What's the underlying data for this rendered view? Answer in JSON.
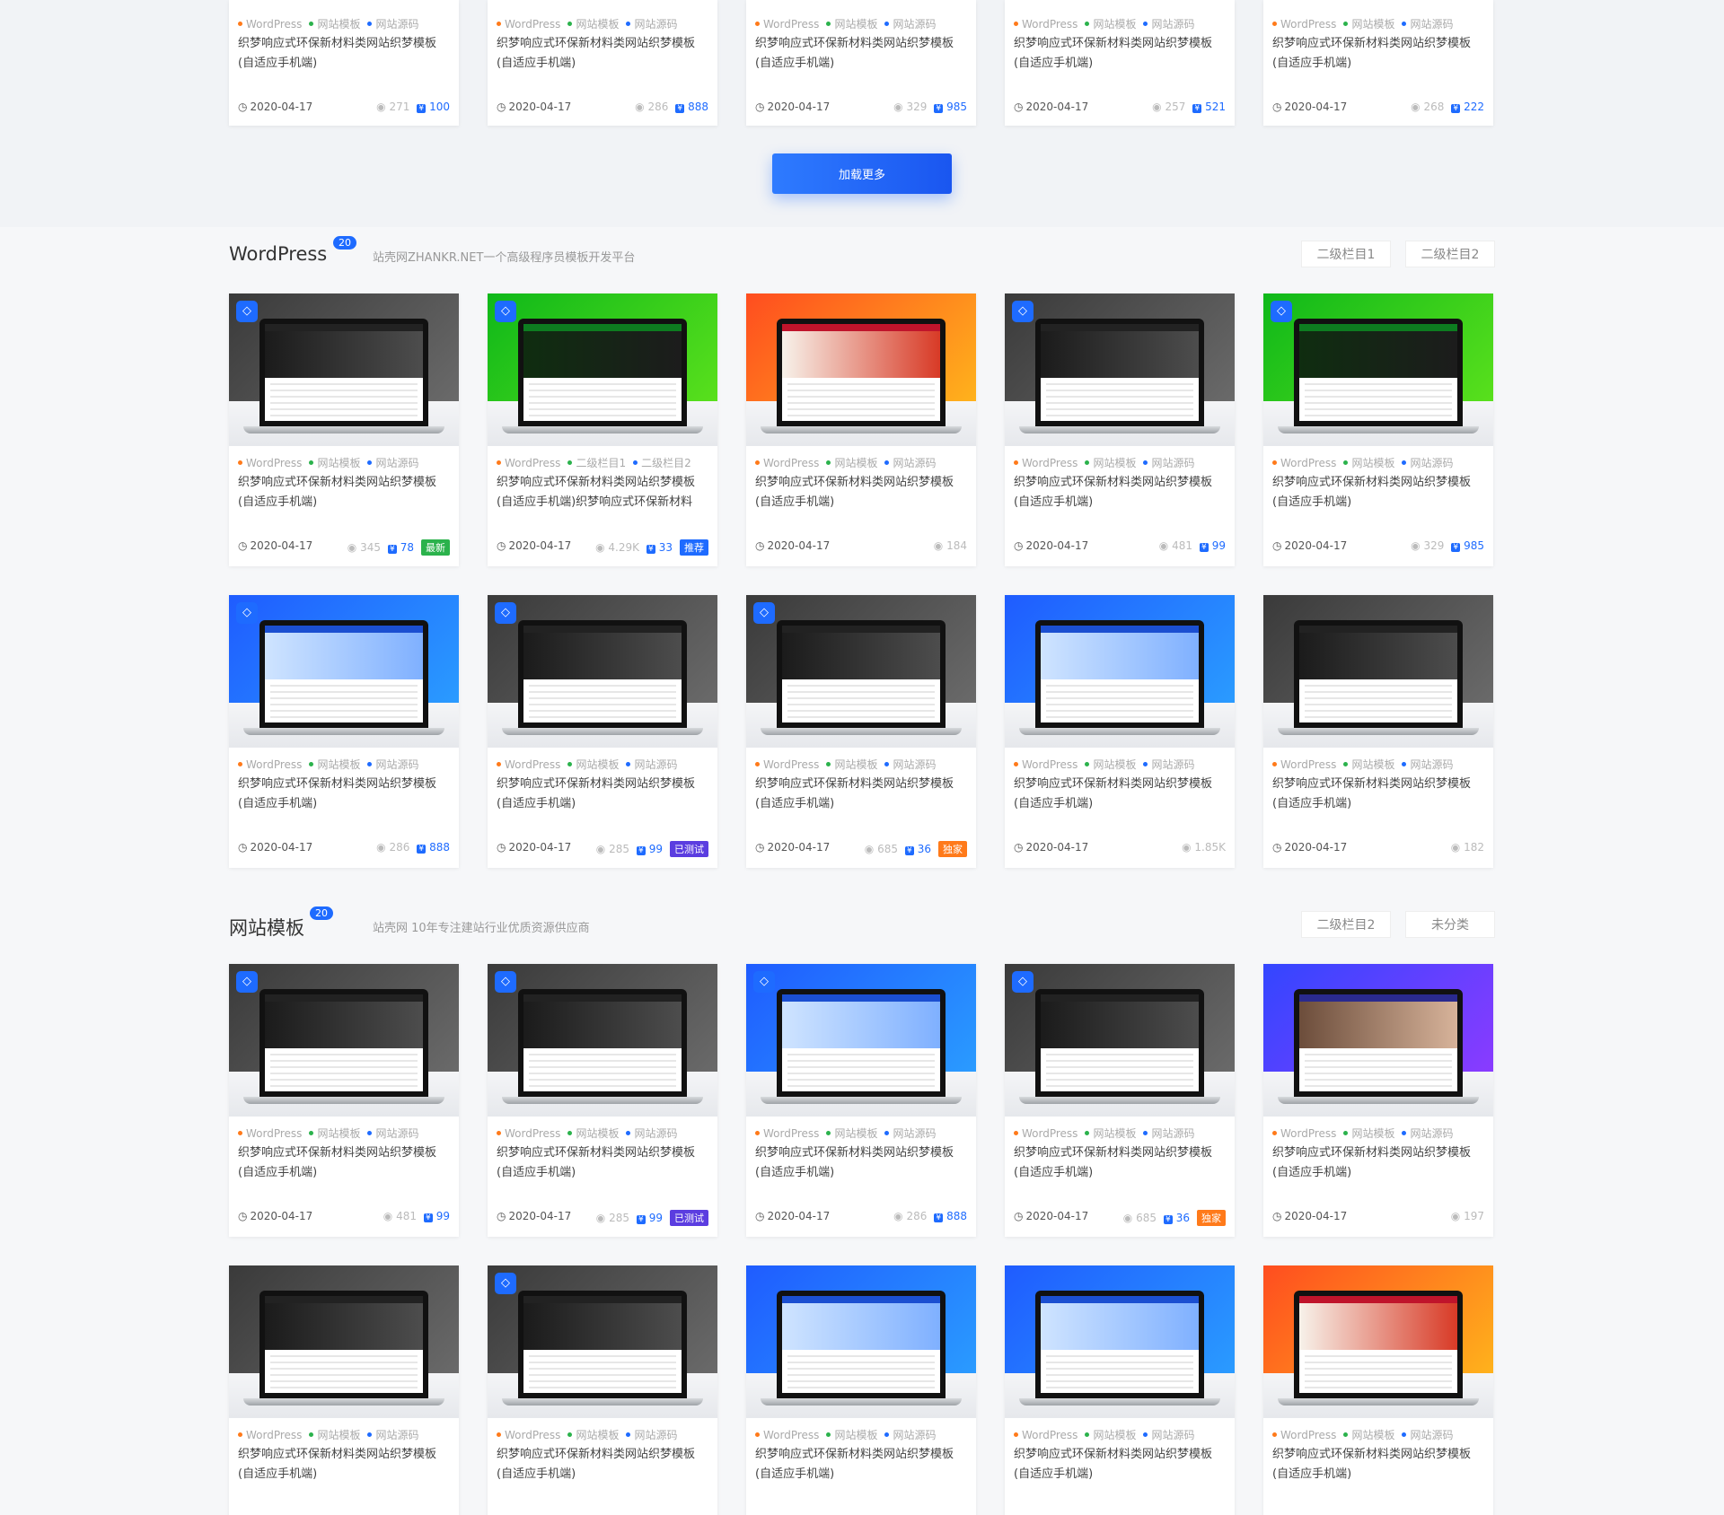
{
  "tag_labels": {
    "wp": "WordPress",
    "tpl": "网站模板",
    "src": "网站源码",
    "c1": "二级栏目1",
    "c2": "二级栏目2"
  },
  "colors": {
    "accent": "#1e6bff",
    "tag_orange": "#ff7a1a",
    "tag_green": "#2bb24c",
    "tag_blue": "#1e6bff"
  },
  "icons": {
    "vip": "diamond-icon",
    "date": "clock-icon",
    "views": "eye-icon",
    "price": "coin-icon"
  },
  "load_more": "加载更多",
  "top_cards": [
    {
      "title": "织梦响应式环保新材料类网站织梦模板(自适应手机端)",
      "date": "2020-04-17",
      "views": "271",
      "price": "100"
    },
    {
      "title": "织梦响应式环保新材料类网站织梦模板(自适应手机端)",
      "date": "2020-04-17",
      "views": "286",
      "price": "888"
    },
    {
      "title": "织梦响应式环保新材料类网站织梦模板(自适应手机端)",
      "date": "2020-04-17",
      "views": "329",
      "price": "985"
    },
    {
      "title": "织梦响应式环保新材料类网站织梦模板(自适应手机端)",
      "date": "2020-04-17",
      "views": "257",
      "price": "521"
    },
    {
      "title": "织梦响应式环保新材料类网站织梦模板(自适应手机端)",
      "date": "2020-04-17",
      "views": "268",
      "price": "222"
    }
  ],
  "sections": [
    {
      "title": "WordPress",
      "count": "20",
      "desc": "站壳网ZHANKR.NET一个高级程序员模板开发平台",
      "tabs": [
        "二级栏目1",
        "二级栏目2"
      ],
      "cards": [
        {
          "title": "织梦响应式环保新材料类网站织梦模板(自适应手机端)",
          "date": "2020-04-17",
          "views": "345",
          "price": "78",
          "badge": "最新",
          "badge_color": "#2bb24c",
          "vip": true,
          "theme": "gray",
          "tags": [
            "wp",
            "tpl",
            "src"
          ]
        },
        {
          "title": "织梦响应式环保新材料类网站织梦模板(自适应手机端)织梦响应式环保新材料",
          "date": "2020-04-17",
          "views": "4.29K",
          "price": "33",
          "badge": "推荐",
          "badge_color": "#1e6bff",
          "vip": true,
          "theme": "green",
          "tags": [
            "wp",
            "c1",
            "c2"
          ]
        },
        {
          "title": "织梦响应式环保新材料类网站织梦模板(自适应手机端)",
          "date": "2020-04-17",
          "views": "184",
          "price": "",
          "badge": "",
          "vip": false,
          "theme": "orange",
          "tags": [
            "wp",
            "tpl",
            "src"
          ]
        },
        {
          "title": "织梦响应式环保新材料类网站织梦模板(自适应手机端)",
          "date": "2020-04-17",
          "views": "481",
          "price": "99",
          "badge": "",
          "vip": true,
          "theme": "gray",
          "tags": [
            "wp",
            "tpl",
            "src"
          ]
        },
        {
          "title": "织梦响应式环保新材料类网站织梦模板(自适应手机端)",
          "date": "2020-04-17",
          "views": "329",
          "price": "985",
          "badge": "",
          "vip": true,
          "theme": "green",
          "tags": [
            "wp",
            "tpl",
            "src"
          ]
        },
        {
          "title": "织梦响应式环保新材料类网站织梦模板(自适应手机端)",
          "date": "2020-04-17",
          "views": "286",
          "price": "888",
          "badge": "",
          "vip": true,
          "theme": "blue",
          "tags": [
            "wp",
            "tpl",
            "src"
          ]
        },
        {
          "title": "织梦响应式环保新材料类网站织梦模板(自适应手机端)",
          "date": "2020-04-17",
          "views": "285",
          "price": "99",
          "badge": "已测试",
          "badge_color": "#5b3de0",
          "vip": true,
          "theme": "gray",
          "tags": [
            "wp",
            "tpl",
            "src"
          ]
        },
        {
          "title": "织梦响应式环保新材料类网站织梦模板(自适应手机端)",
          "date": "2020-04-17",
          "views": "685",
          "price": "36",
          "badge": "独家",
          "badge_color": "#ff7a1a",
          "vip": true,
          "theme": "gray",
          "tags": [
            "wp",
            "tpl",
            "src"
          ]
        },
        {
          "title": "织梦响应式环保新材料类网站织梦模板(自适应手机端)",
          "date": "2020-04-17",
          "views": "1.85K",
          "price": "",
          "badge": "",
          "vip": false,
          "theme": "blue",
          "tags": [
            "wp",
            "tpl",
            "src"
          ]
        },
        {
          "title": "织梦响应式环保新材料类网站织梦模板(自适应手机端)",
          "date": "2020-04-17",
          "views": "182",
          "price": "",
          "badge": "",
          "vip": false,
          "theme": "gray",
          "tags": [
            "wp",
            "tpl",
            "src"
          ]
        }
      ]
    },
    {
      "title": "网站模板",
      "count": "20",
      "desc": "站壳网 10年专注建站行业优质资源供应商",
      "tabs": [
        "二级栏目2",
        "未分类"
      ],
      "cards": [
        {
          "title": "织梦响应式环保新材料类网站织梦模板(自适应手机端)",
          "date": "2020-04-17",
          "views": "481",
          "price": "99",
          "badge": "",
          "vip": true,
          "theme": "gray",
          "tags": [
            "wp",
            "tpl",
            "src"
          ]
        },
        {
          "title": "织梦响应式环保新材料类网站织梦模板(自适应手机端)",
          "date": "2020-04-17",
          "views": "285",
          "price": "99",
          "badge": "已测试",
          "badge_color": "#5b3de0",
          "vip": true,
          "theme": "gray",
          "tags": [
            "wp",
            "tpl",
            "src"
          ]
        },
        {
          "title": "织梦响应式环保新材料类网站织梦模板(自适应手机端)",
          "date": "2020-04-17",
          "views": "286",
          "price": "888",
          "badge": "",
          "vip": true,
          "theme": "blue",
          "tags": [
            "wp",
            "tpl",
            "src"
          ]
        },
        {
          "title": "织梦响应式环保新材料类网站织梦模板(自适应手机端)",
          "date": "2020-04-17",
          "views": "685",
          "price": "36",
          "badge": "独家",
          "badge_color": "#ff7a1a",
          "vip": true,
          "theme": "gray",
          "tags": [
            "wp",
            "tpl",
            "src"
          ]
        },
        {
          "title": "织梦响应式环保新材料类网站织梦模板(自适应手机端)",
          "date": "2020-04-17",
          "views": "197",
          "price": "",
          "badge": "",
          "vip": false,
          "theme": "purple",
          "tags": [
            "wp",
            "tpl",
            "src"
          ]
        },
        {
          "title": "织梦响应式环保新材料类网站织梦模板(自适应手机端)",
          "date": "",
          "views": "",
          "price": "",
          "badge": "",
          "vip": false,
          "theme": "gray",
          "tags": [
            "wp",
            "tpl",
            "src"
          ]
        },
        {
          "title": "织梦响应式环保新材料类网站织梦模板(自适应手机端)",
          "date": "",
          "views": "",
          "price": "",
          "badge": "",
          "vip": true,
          "theme": "gray",
          "tags": [
            "wp",
            "tpl",
            "src"
          ]
        },
        {
          "title": "织梦响应式环保新材料类网站织梦模板(自适应手机端)",
          "date": "",
          "views": "",
          "price": "",
          "badge": "",
          "vip": false,
          "theme": "blue",
          "tags": [
            "wp",
            "tpl",
            "src"
          ]
        },
        {
          "title": "织梦响应式环保新材料类网站织梦模板(自适应手机端)",
          "date": "",
          "views": "",
          "price": "",
          "badge": "",
          "vip": false,
          "theme": "blue",
          "tags": [
            "wp",
            "tpl",
            "src"
          ]
        },
        {
          "title": "织梦响应式环保新材料类网站织梦模板(自适应手机端)",
          "date": "",
          "views": "",
          "price": "",
          "badge": "",
          "vip": false,
          "theme": "orange",
          "tags": [
            "wp",
            "tpl",
            "src"
          ]
        }
      ]
    }
  ]
}
